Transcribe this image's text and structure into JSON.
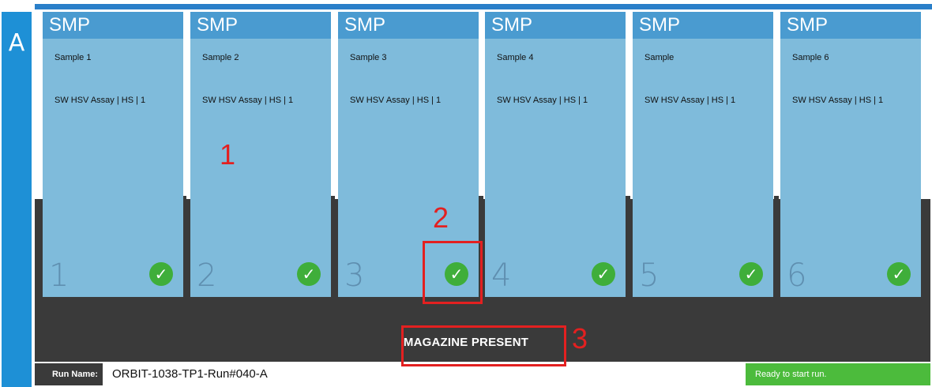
{
  "bay": {
    "letter": "A"
  },
  "cards": [
    {
      "header": "SMP",
      "sample": "Sample 1",
      "assay": "SW HSV Assay | HS | 1",
      "position": "1",
      "status_icon": "check-circle-icon"
    },
    {
      "header": "SMP",
      "sample": "Sample 2",
      "assay": "SW HSV Assay | HS | 1",
      "position": "2",
      "status_icon": "check-circle-icon"
    },
    {
      "header": "SMP",
      "sample": "Sample 3",
      "assay": "SW HSV Assay | HS | 1",
      "position": "3",
      "status_icon": "check-circle-icon"
    },
    {
      "header": "SMP",
      "sample": "Sample 4",
      "assay": "SW HSV Assay | HS | 1",
      "position": "4",
      "status_icon": "check-circle-icon"
    },
    {
      "header": "SMP",
      "sample": "Sample",
      "assay": "SW HSV Assay | HS | 1",
      "position": "5",
      "status_icon": "check-circle-icon"
    },
    {
      "header": "SMP",
      "sample": "Sample 6",
      "assay": "SW HSV Assay | HS | 1",
      "position": "6",
      "status_icon": "check-circle-icon"
    }
  ],
  "tray": {
    "message": "MAGAZINE PRESENT"
  },
  "run": {
    "label": "Run Name:",
    "name": "ORBIT-1038-TP1-Run#040-A"
  },
  "status": {
    "text": "Ready to start run."
  },
  "annotations": [
    "1",
    "2",
    "3"
  ],
  "colors": {
    "accent": "#4a9bd0",
    "card": "#7fbbdb",
    "tray": "#3a3a3a",
    "ok": "#3fae3a",
    "annotation": "#e32020"
  }
}
